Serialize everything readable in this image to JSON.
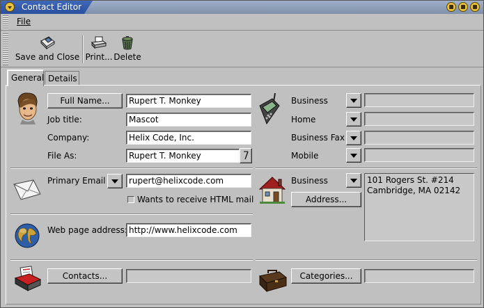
{
  "window": {
    "title": "Contact Editor"
  },
  "menu": {
    "file": "File"
  },
  "toolbar": {
    "save_close": "Save and Close",
    "print": "Print...",
    "delete": "Delete"
  },
  "tabs": {
    "general": "General",
    "details": "Details"
  },
  "identity": {
    "full_name_button": "Full Name...",
    "full_name_value": "Rupert T. Monkey",
    "job_title_label": "Job title:",
    "job_title_value": "Mascot",
    "company_label": "Company:",
    "company_value": "Helix Code, Inc.",
    "file_as_label": "File As:",
    "file_as_value": "Rupert T. Monkey"
  },
  "phones": {
    "business": "Business",
    "home": "Home",
    "business_fax": "Business Fax",
    "mobile": "Mobile"
  },
  "email": {
    "label": "Primary Email",
    "value": "rupert@helixcode.com",
    "html_mail": "Wants to receive HTML mail"
  },
  "web": {
    "label": "Web page address:",
    "value": "http://www.helixcode.com"
  },
  "address": {
    "type": "Business",
    "button": "Address...",
    "line1": "101 Rogers St. #214",
    "line2": "Cambridge, MA 02142"
  },
  "contacts_button": "Contacts...",
  "categories_button": "Categories...",
  "colors": {
    "title_bar": "#2a4f9f",
    "window_bg": "#c0c0c0"
  }
}
